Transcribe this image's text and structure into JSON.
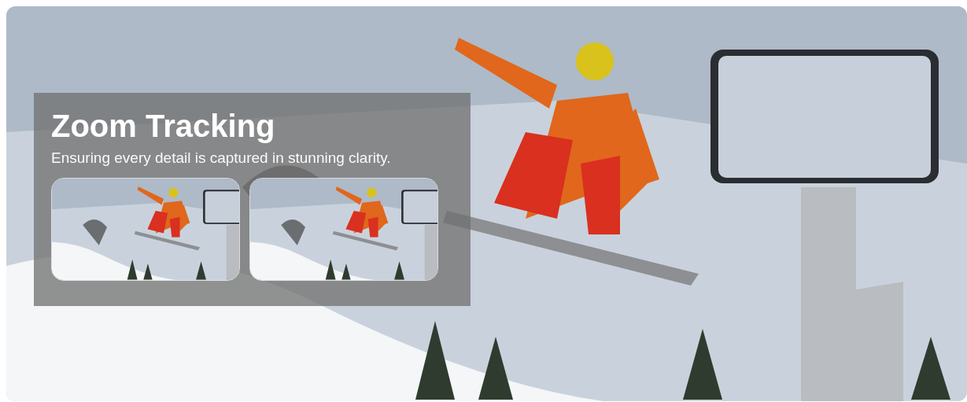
{
  "heading": "Zoom Tracking",
  "subtitle": "Ensuring every detail is captured in stunning clarity."
}
